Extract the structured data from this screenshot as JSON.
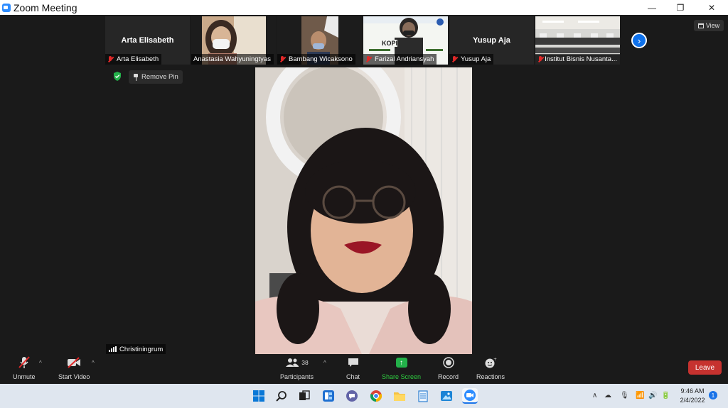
{
  "window": {
    "title": "Zoom Meeting",
    "minimize": "—",
    "restore": "❐",
    "close": "✕"
  },
  "view_button": {
    "label": "View"
  },
  "gallery": [
    {
      "big_name": "Arta Elisabeth",
      "label": "Arta Elisabeth",
      "muted": true,
      "video": false
    },
    {
      "big_name": "",
      "label": "Anastasia Wahyuningtyas",
      "muted": false,
      "video": true
    },
    {
      "big_name": "",
      "label": "Bambang Wicaksono",
      "muted": true,
      "video": true
    },
    {
      "big_name": "",
      "label": "Farizal Andriansyah",
      "muted": true,
      "video": true,
      "slide_text": "KOPI"
    },
    {
      "big_name": "Yusup Aja",
      "label": "Yusup Aja",
      "muted": true,
      "video": false
    },
    {
      "big_name": "",
      "label": "Institut Bisnis Nusanta...",
      "muted": true,
      "video": true
    }
  ],
  "pin": {
    "label": "Remove Pin"
  },
  "active_speaker": {
    "name": "Christiningrum"
  },
  "toolbar": {
    "unmute": "Unmute",
    "start_video": "Start Video",
    "participants": "Participants",
    "participants_count": "38",
    "chat": "Chat",
    "share_screen": "Share Screen",
    "record": "Record",
    "reactions": "Reactions",
    "leave": "Leave"
  },
  "colors": {
    "accent": "#0e71eb",
    "leave": "#c6322f",
    "share": "#23b14a",
    "muted": "#e02828"
  },
  "taskbar": {
    "time": "9:46 AM",
    "date": "2/4/2022",
    "notifications": "1",
    "icons": [
      "windows-start-icon",
      "search-icon",
      "task-view-icon",
      "widgets-icon",
      "teams-chat-icon",
      "chrome-icon",
      "file-explorer-icon",
      "notepad-icon",
      "photos-icon",
      "zoom-icon"
    ]
  }
}
